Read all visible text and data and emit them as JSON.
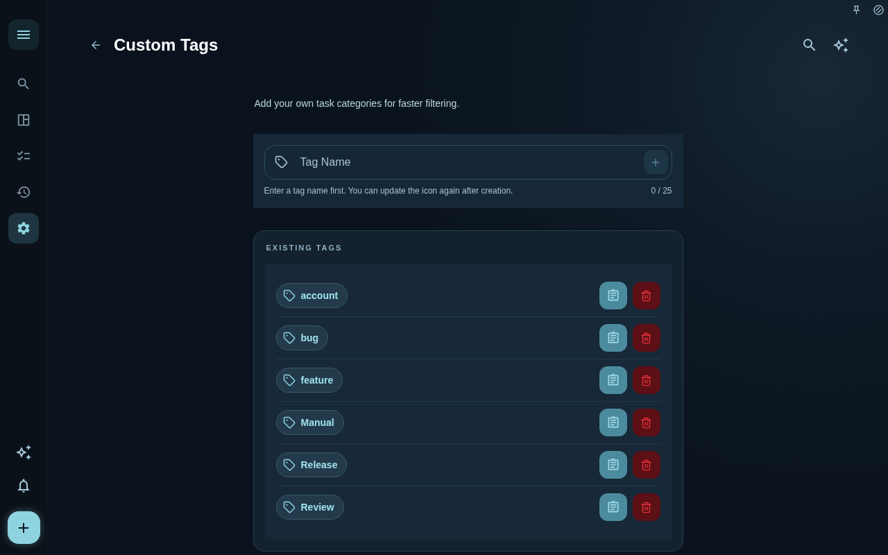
{
  "sidebar": {
    "items": [
      {
        "kind": "search",
        "selected": false
      },
      {
        "kind": "dashboard",
        "selected": false
      },
      {
        "kind": "checklist",
        "selected": false
      },
      {
        "kind": "history",
        "selected": false
      },
      {
        "kind": "settings",
        "selected": true
      }
    ]
  },
  "header": {
    "title": "Custom Tags"
  },
  "description": "Add your own task categories for faster filtering.",
  "form": {
    "placeholder": "Tag Name",
    "hint": "Enter a tag name first. You can update the icon again after creation.",
    "counter": "0 / 25",
    "add_button": {
      "disabled": true
    }
  },
  "tags_panel": {
    "heading": "EXISTING TAGS",
    "tags": [
      {
        "label": "account"
      },
      {
        "label": "bug"
      },
      {
        "label": "feature"
      },
      {
        "label": "Manual"
      },
      {
        "label": "Release"
      },
      {
        "label": "Review"
      }
    ]
  }
}
